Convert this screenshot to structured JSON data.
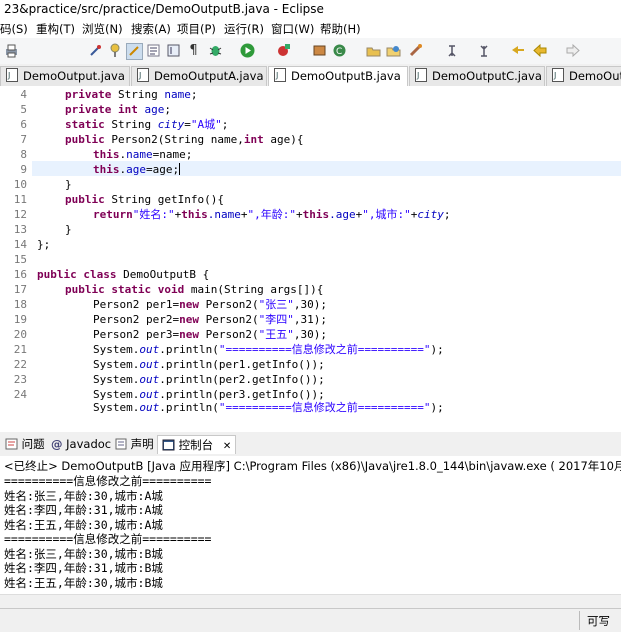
{
  "window": {
    "title": "23&practice/src/practice/DemoOutputB.java  -  Eclipse"
  },
  "menu": {
    "items": [
      "码(S)",
      "重构(T)",
      "浏览(N)",
      "搜索(A)",
      "项目(P)",
      "运行(R)",
      "窗口(W)",
      "帮助(H)"
    ]
  },
  "toolbar": {
    "icons": [
      "print-icon",
      "link-icon",
      "pin-icon",
      "mark-occurrences-icon",
      "show-whitespace-icon",
      "block-select-icon",
      "paragraph-icon",
      "debug-icon",
      "run-icon",
      "coverage-icon",
      "new-class-icon",
      "new-package-icon",
      "open-type-icon",
      "open-folder-icon",
      "search-icon",
      "annotation-next-icon",
      "annotation-prev-icon",
      "back-icon",
      "forward-icon"
    ]
  },
  "editor_tabs": [
    {
      "label": "DemoOutput.java",
      "active": false
    },
    {
      "label": "DemoOutputA.java",
      "active": false
    },
    {
      "label": "DemoOutputB.java",
      "active": true
    },
    {
      "label": "DemoOutputC.java",
      "active": false
    },
    {
      "label": "DemoOutp",
      "active": false
    }
  ],
  "editor": {
    "line_numbers": [
      "4",
      "5",
      "6",
      "7",
      "8",
      "9",
      "10",
      "11",
      "12",
      "13",
      "14",
      "15",
      "16",
      "17",
      "18",
      "19",
      "20",
      "21",
      "22",
      "23",
      "24"
    ],
    "lines": {
      "l4": {
        "kw": "private",
        "rest": " String ",
        "fld": "name",
        "end": ";"
      },
      "l5": {
        "kw": "private",
        "kw2": "int",
        "fld": "age",
        "end": ";"
      },
      "l6": {
        "kw": "static",
        "rest": " String ",
        "sfld": "city",
        "eq": "=",
        "str": "\"A城\"",
        "end": ";"
      },
      "l7": {
        "kw": "public",
        "rest": " Person2(String name,",
        "kw2": "int",
        "rest2": " age){"
      },
      "l8": {
        "kw": "this",
        "dot": ".",
        "fld": "name",
        "rest": "=name;"
      },
      "l9": {
        "kw": "this",
        "dot": ".",
        "fld": "age",
        "rest": "=age;"
      },
      "l10": {
        "text": "}"
      },
      "l11": {
        "kw": "public",
        "rest": " String getInfo(){"
      },
      "l12": {
        "kw": "return",
        "str1": "\"姓名:\"",
        "p1": "+",
        "kw2": "this",
        "f1": ".name",
        "p2": "+",
        "str2": "\",年龄:\"",
        "p3": "+",
        "kw3": "this",
        "f2": ".age",
        "p4": "+",
        "str3": "\",城市:\"",
        "p5": "+",
        "sfld": "city",
        "end": ";"
      },
      "l13": {
        "text": "}"
      },
      "l14": {
        "text": "};"
      },
      "l15": {
        "text": ""
      },
      "l16": {
        "kw": "public",
        "kw2": "class",
        "rest": " DemoOutputB {"
      },
      "l17": {
        "kw": "public",
        "kw2": "static",
        "kw3": "void",
        "rest": " main(String args[]){"
      },
      "l18": {
        "pre": "Person2 per1=",
        "kw": "new",
        "mid": " Person2(",
        "str": "\"张三\"",
        "end": ",30);"
      },
      "l19": {
        "pre": "Person2 per2=",
        "kw": "new",
        "mid": " Person2(",
        "str": "\"李四\"",
        "end": ",31);"
      },
      "l20": {
        "pre": "Person2 per3=",
        "kw": "new",
        "mid": " Person2(",
        "str": "\"王五\"",
        "end": ",30);"
      },
      "l21": {
        "pre": "System.",
        "sfld": "out",
        "mid": ".println(",
        "str": "\"==========信息修改之前==========\"",
        "end": ");"
      },
      "l22": {
        "pre": "System.",
        "sfld": "out",
        "rest": ".println(per1.getInfo());"
      },
      "l23": {
        "pre": "System.",
        "sfld": "out",
        "rest": ".println(per2.getInfo());"
      },
      "l24": {
        "pre": "System.",
        "sfld": "out",
        "rest": ".println(per3.getInfo());"
      },
      "l25": {
        "pre": "System.",
        "sfld": "out",
        "mid": ".println(",
        "str": "\"==========信息修改之前==========\"",
        "end": ");"
      }
    }
  },
  "view_tabs": [
    {
      "label": "问题",
      "icon": "problems-icon"
    },
    {
      "label": "Javadoc",
      "icon": "javadoc-icon"
    },
    {
      "label": "声明",
      "icon": "declaration-icon"
    },
    {
      "label": "控制台",
      "icon": "console-icon",
      "active": true
    }
  ],
  "console": {
    "header": "<已终止> DemoOutputB [Java 应用程序] C:\\Program Files (x86)\\Java\\jre1.8.0_144\\bin\\javaw.exe ( 2017年10月31日 下午7:34:0",
    "lines": [
      "==========信息修改之前==========",
      "姓名:张三,年龄:30,城市:A城",
      "姓名:李四,年龄:31,城市:A城",
      "姓名:王五,年龄:30,城市:A城",
      "==========信息修改之前==========",
      "姓名:张三,年龄:30,城市:B城",
      "姓名:李四,年龄:31,城市:B城",
      "姓名:王五,年龄:30,城市:B城"
    ]
  },
  "status": {
    "mode": "可写"
  }
}
